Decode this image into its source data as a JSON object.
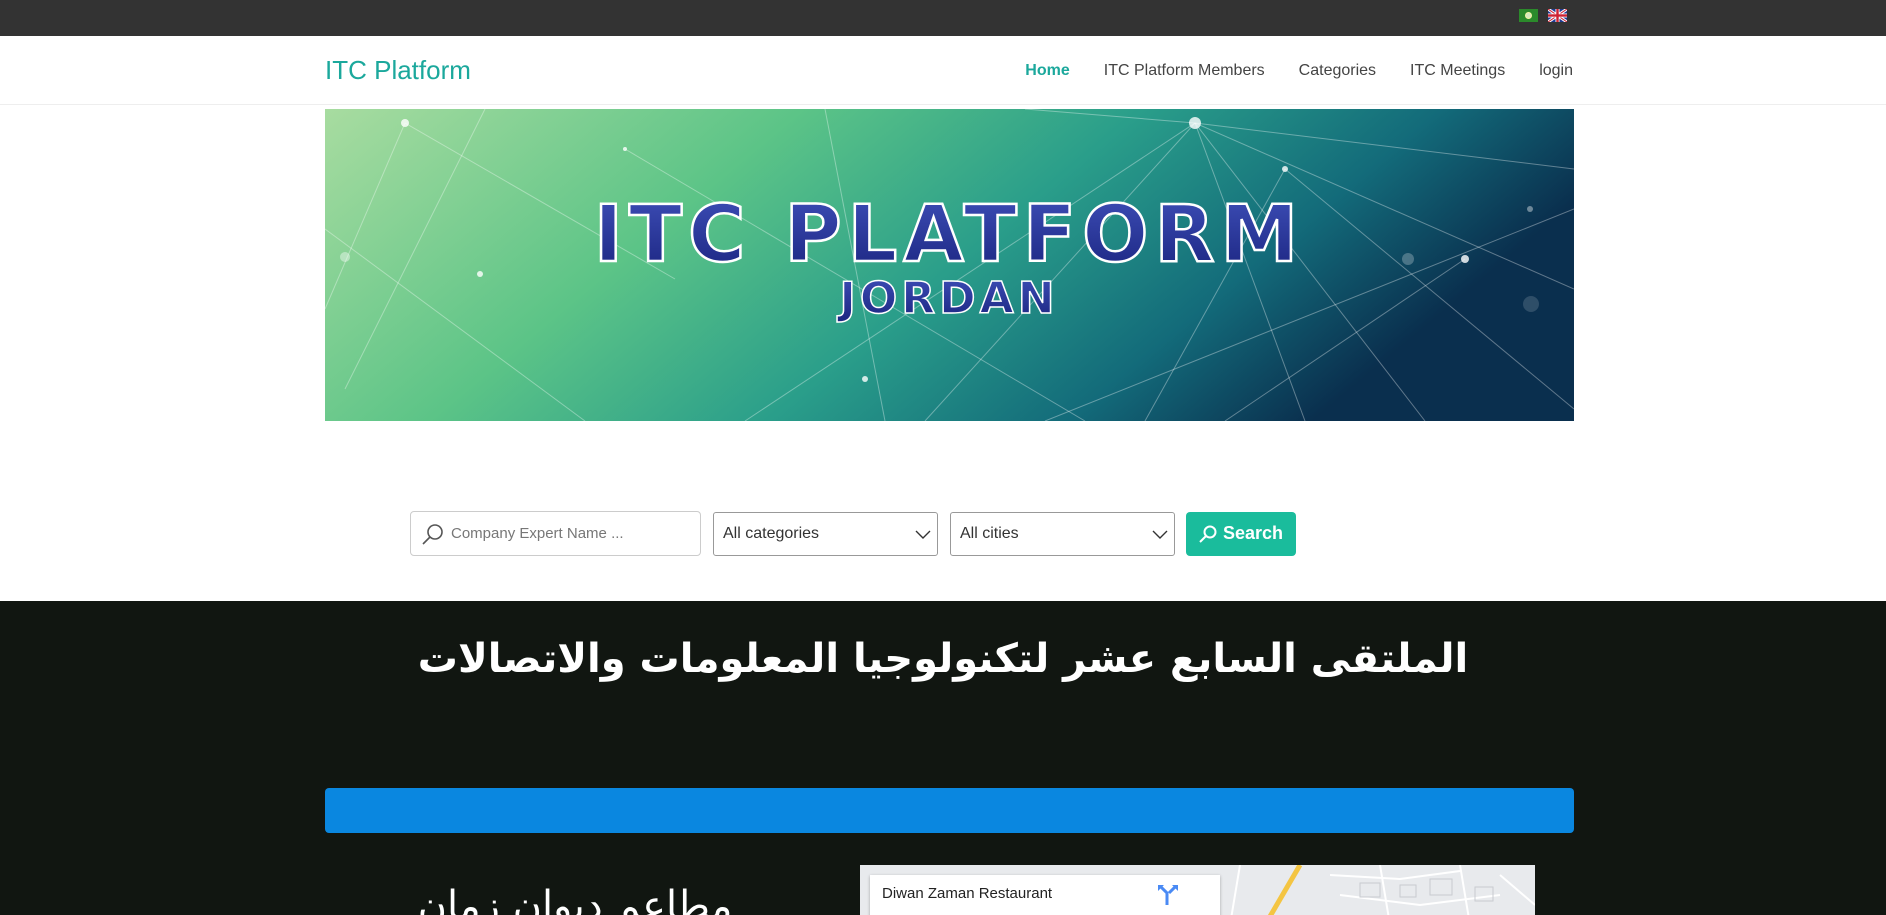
{
  "languages": [
    {
      "code": "ar",
      "icon": "arabic-flag-icon"
    },
    {
      "code": "en",
      "icon": "uk-flag-icon"
    }
  ],
  "brand": "ITC Platform",
  "nav": {
    "home": "Home",
    "members": "ITC Platform Members",
    "categories": "Categories",
    "meetings": "ITC Meetings",
    "login": "login"
  },
  "banner": {
    "title": "ITC PLATFORM",
    "subtitle": "JORDAN"
  },
  "search": {
    "placeholder": "Company Expert Name ...",
    "category_value": "All categories",
    "city_value": "All cities",
    "button_label": "Search"
  },
  "event": {
    "title": "الملتقى السابع عشر لتكنولوجيا المعلومات والاتصالات",
    "venue_title": "مطاعم ديوان زمان"
  },
  "map": {
    "place_name": "Diwan Zaman Restaurant"
  },
  "colors": {
    "brand": "#1ba89c",
    "search_button": "#1abc9c",
    "top_bar": "#333333",
    "dark_section": "#111611",
    "blue_bar": "#0a87e0"
  }
}
